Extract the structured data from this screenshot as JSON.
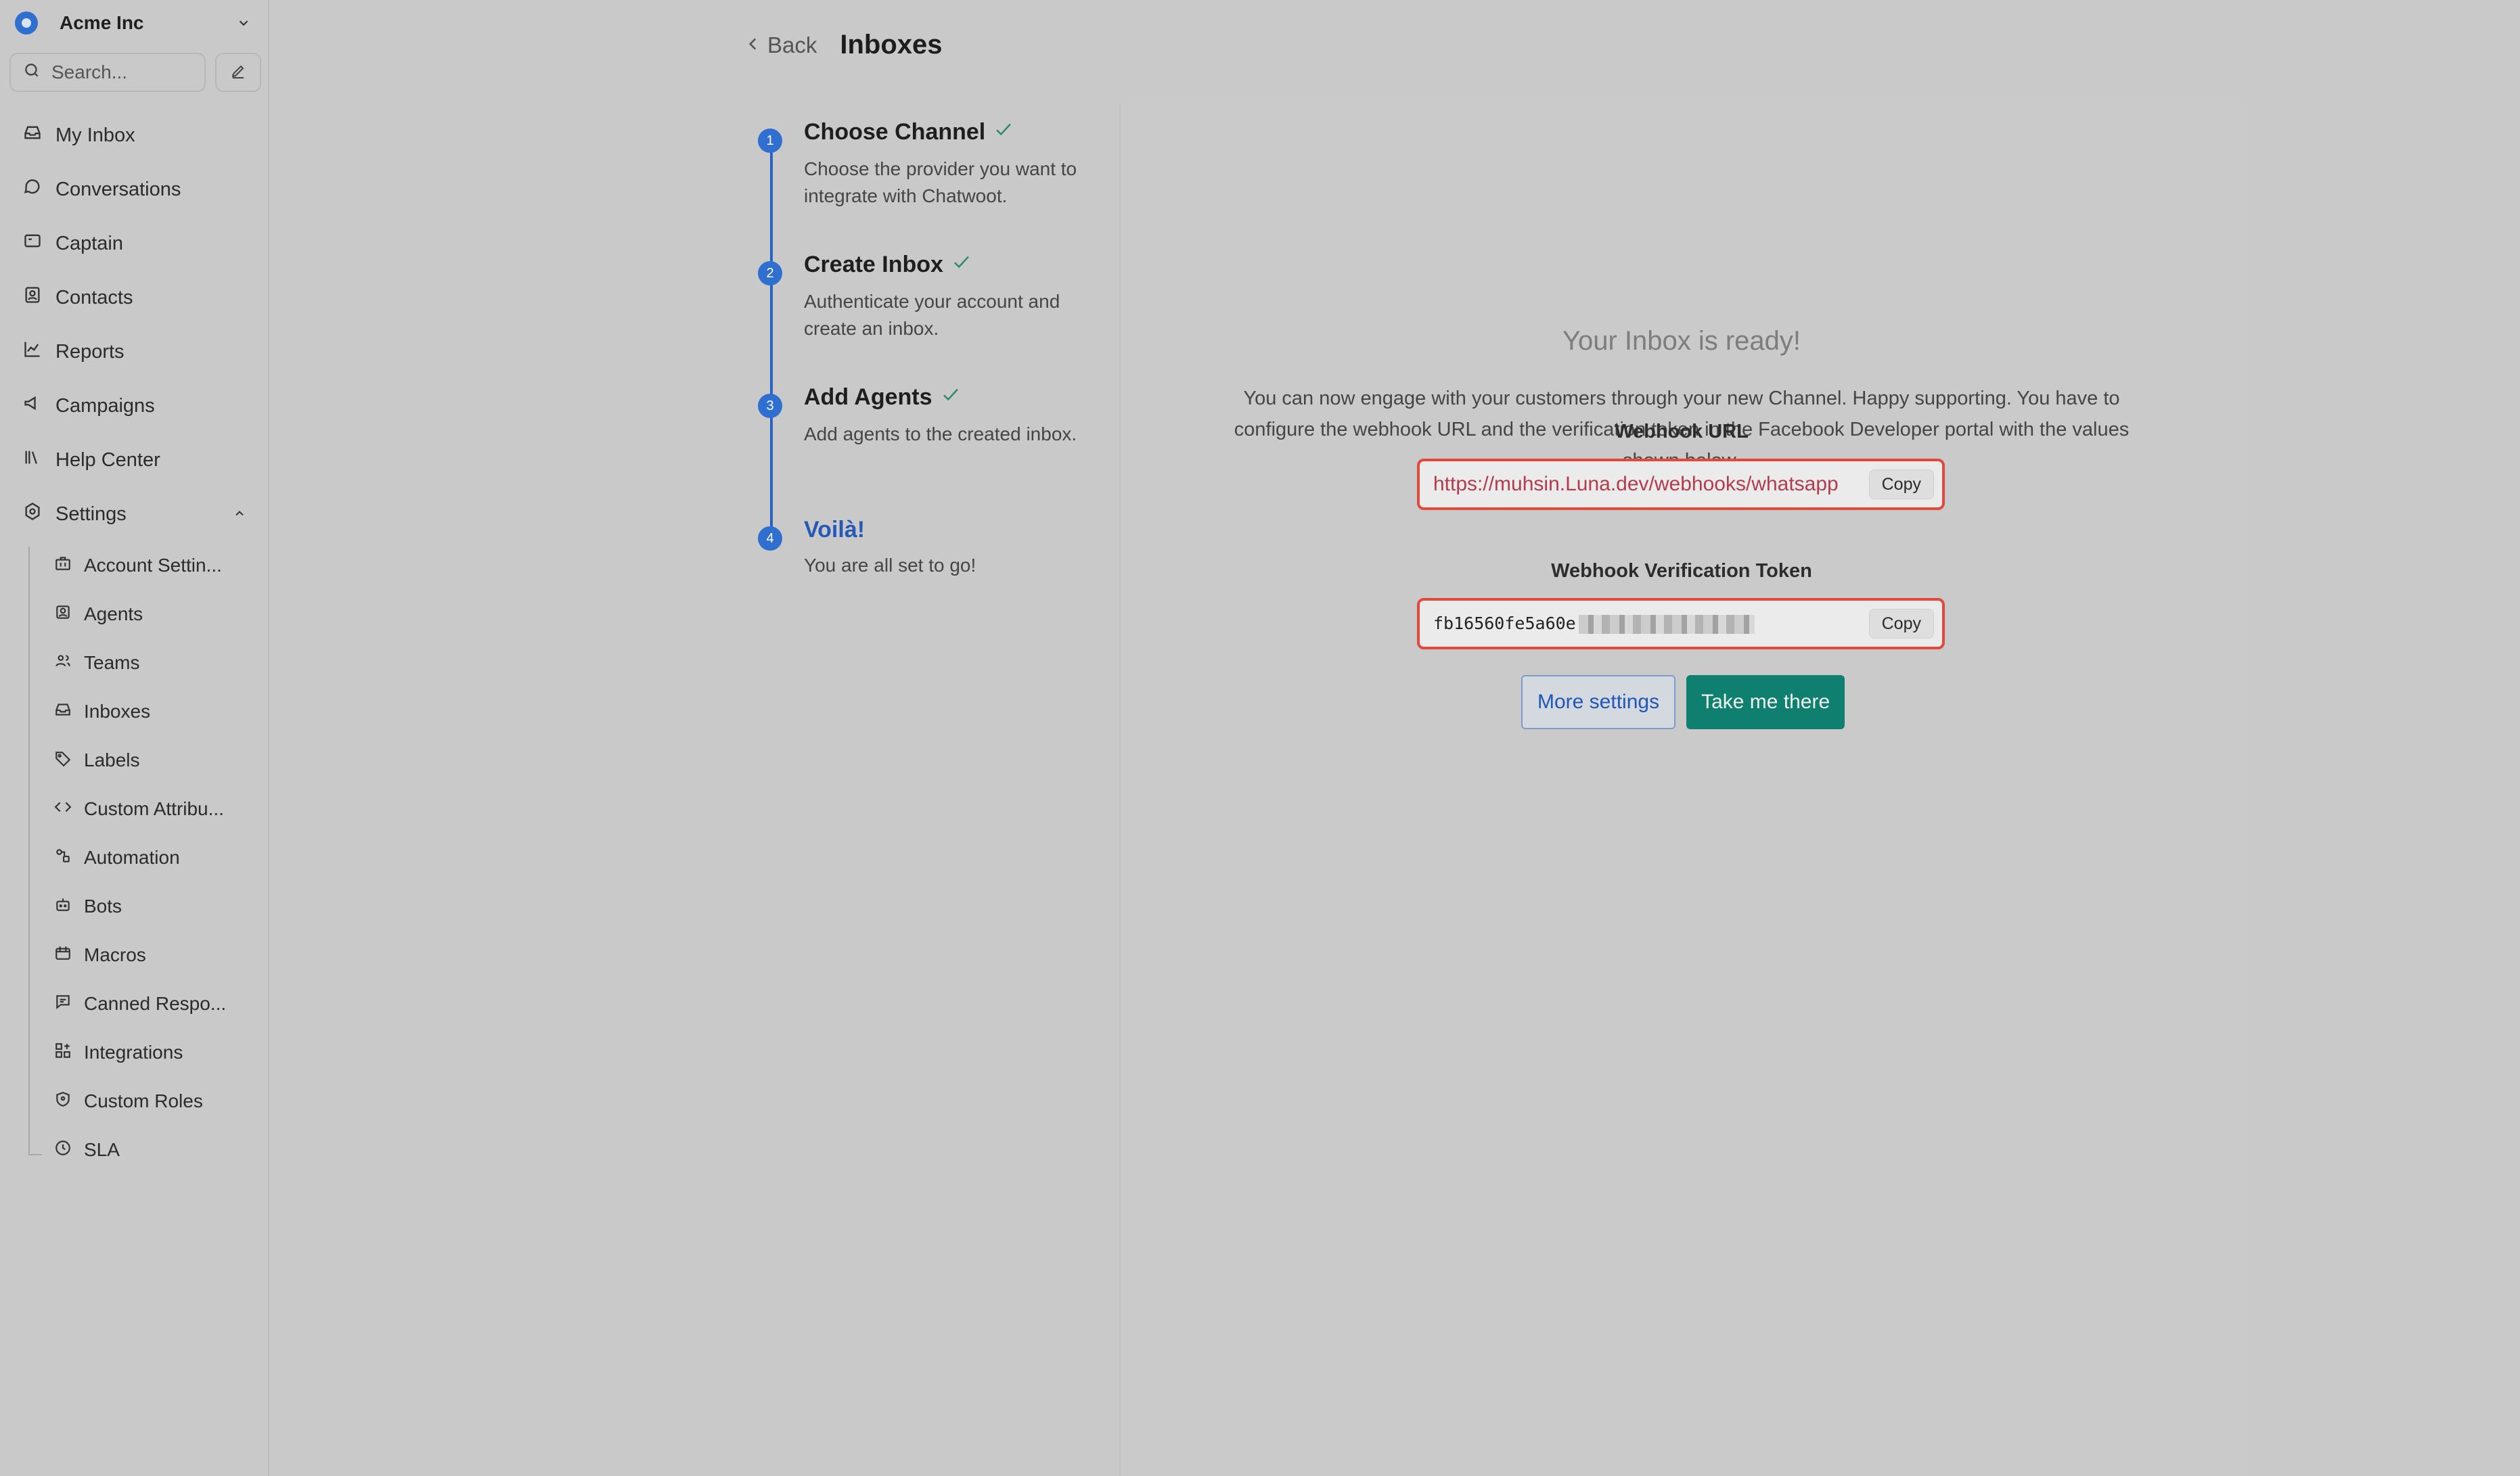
{
  "sidebar": {
    "account_name": "Acme Inc",
    "search_placeholder": "Search...",
    "nav": [
      {
        "label": "My Inbox",
        "icon": "inbox-icon"
      },
      {
        "label": "Conversations",
        "icon": "chat-bubble-icon"
      },
      {
        "label": "Captain",
        "icon": "captain-icon"
      },
      {
        "label": "Contacts",
        "icon": "contact-card-icon"
      },
      {
        "label": "Reports",
        "icon": "chart-line-icon"
      },
      {
        "label": "Campaigns",
        "icon": "megaphone-icon"
      },
      {
        "label": "Help Center",
        "icon": "library-icon"
      },
      {
        "label": "Settings",
        "icon": "settings-icon"
      }
    ],
    "settings_items": [
      {
        "label": "Account Settin...",
        "icon": "briefcase-icon"
      },
      {
        "label": "Agents",
        "icon": "agent-icon"
      },
      {
        "label": "Teams",
        "icon": "team-icon"
      },
      {
        "label": "Inboxes",
        "icon": "inbox-icon"
      },
      {
        "label": "Labels",
        "icon": "tag-icon"
      },
      {
        "label": "Custom Attribu...",
        "icon": "code-icon"
      },
      {
        "label": "Automation",
        "icon": "automation-icon"
      },
      {
        "label": "Bots",
        "icon": "bot-icon"
      },
      {
        "label": "Macros",
        "icon": "macro-icon"
      },
      {
        "label": "Canned Respo...",
        "icon": "canned-response-icon"
      },
      {
        "label": "Integrations",
        "icon": "integrations-icon"
      },
      {
        "label": "Custom Roles",
        "icon": "shield-icon"
      },
      {
        "label": "SLA",
        "icon": "sla-clock-icon"
      }
    ]
  },
  "header": {
    "back_label": "Back",
    "title": "Inboxes"
  },
  "steps": [
    {
      "number": "1",
      "title": "Choose Channel",
      "description": "Choose the provider you want to integrate with Chatwoot.",
      "done": true
    },
    {
      "number": "2",
      "title": "Create Inbox",
      "description": "Authenticate your account and create an inbox.",
      "done": true
    },
    {
      "number": "3",
      "title": "Add Agents",
      "description": "Add agents to the created inbox.",
      "done": true
    },
    {
      "number": "4",
      "title": "Voilà!",
      "description": "You are all set to go!",
      "done": false
    }
  ],
  "ready": {
    "title": "Your Inbox is ready!",
    "description": "You can now engage with your customers through your new Channel. Happy supporting. You have to configure the webhook URL and the verification token in the Facebook Developer portal with the values shown below.",
    "webhook_url_label": "Webhook URL",
    "webhook_url": "https://muhsin.Luna.dev/webhooks/whatsapp",
    "token_label": "Webhook Verification Token",
    "token_visible": "fb16560fe5a60e",
    "copy_label": "Copy",
    "more_settings_label": "More settings",
    "take_me_there_label": "Take me there"
  },
  "colors": {
    "accent": "#2e6fcf",
    "primary_button": "#0f7f70",
    "highlight_border": "#e0493c"
  }
}
